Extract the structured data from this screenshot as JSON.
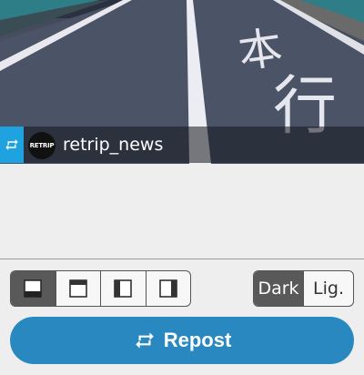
{
  "post": {
    "username": "retrip_news",
    "avatar_text": "RETRIP",
    "photo_road_text_1": "本",
    "photo_road_text_2": "行"
  },
  "layout_options": [
    {
      "name": "layout-bottom",
      "selected": true
    },
    {
      "name": "layout-top",
      "selected": false
    },
    {
      "name": "layout-left",
      "selected": false
    },
    {
      "name": "layout-right",
      "selected": false
    }
  ],
  "theme": {
    "dark_label": "Dark",
    "light_label": "Lig.",
    "selected": "Dark"
  },
  "repost_button": {
    "label": "Repost"
  },
  "colors": {
    "accent": "#2a88c0",
    "badge": "#1ea3e0",
    "selected_segment": "#595959"
  }
}
